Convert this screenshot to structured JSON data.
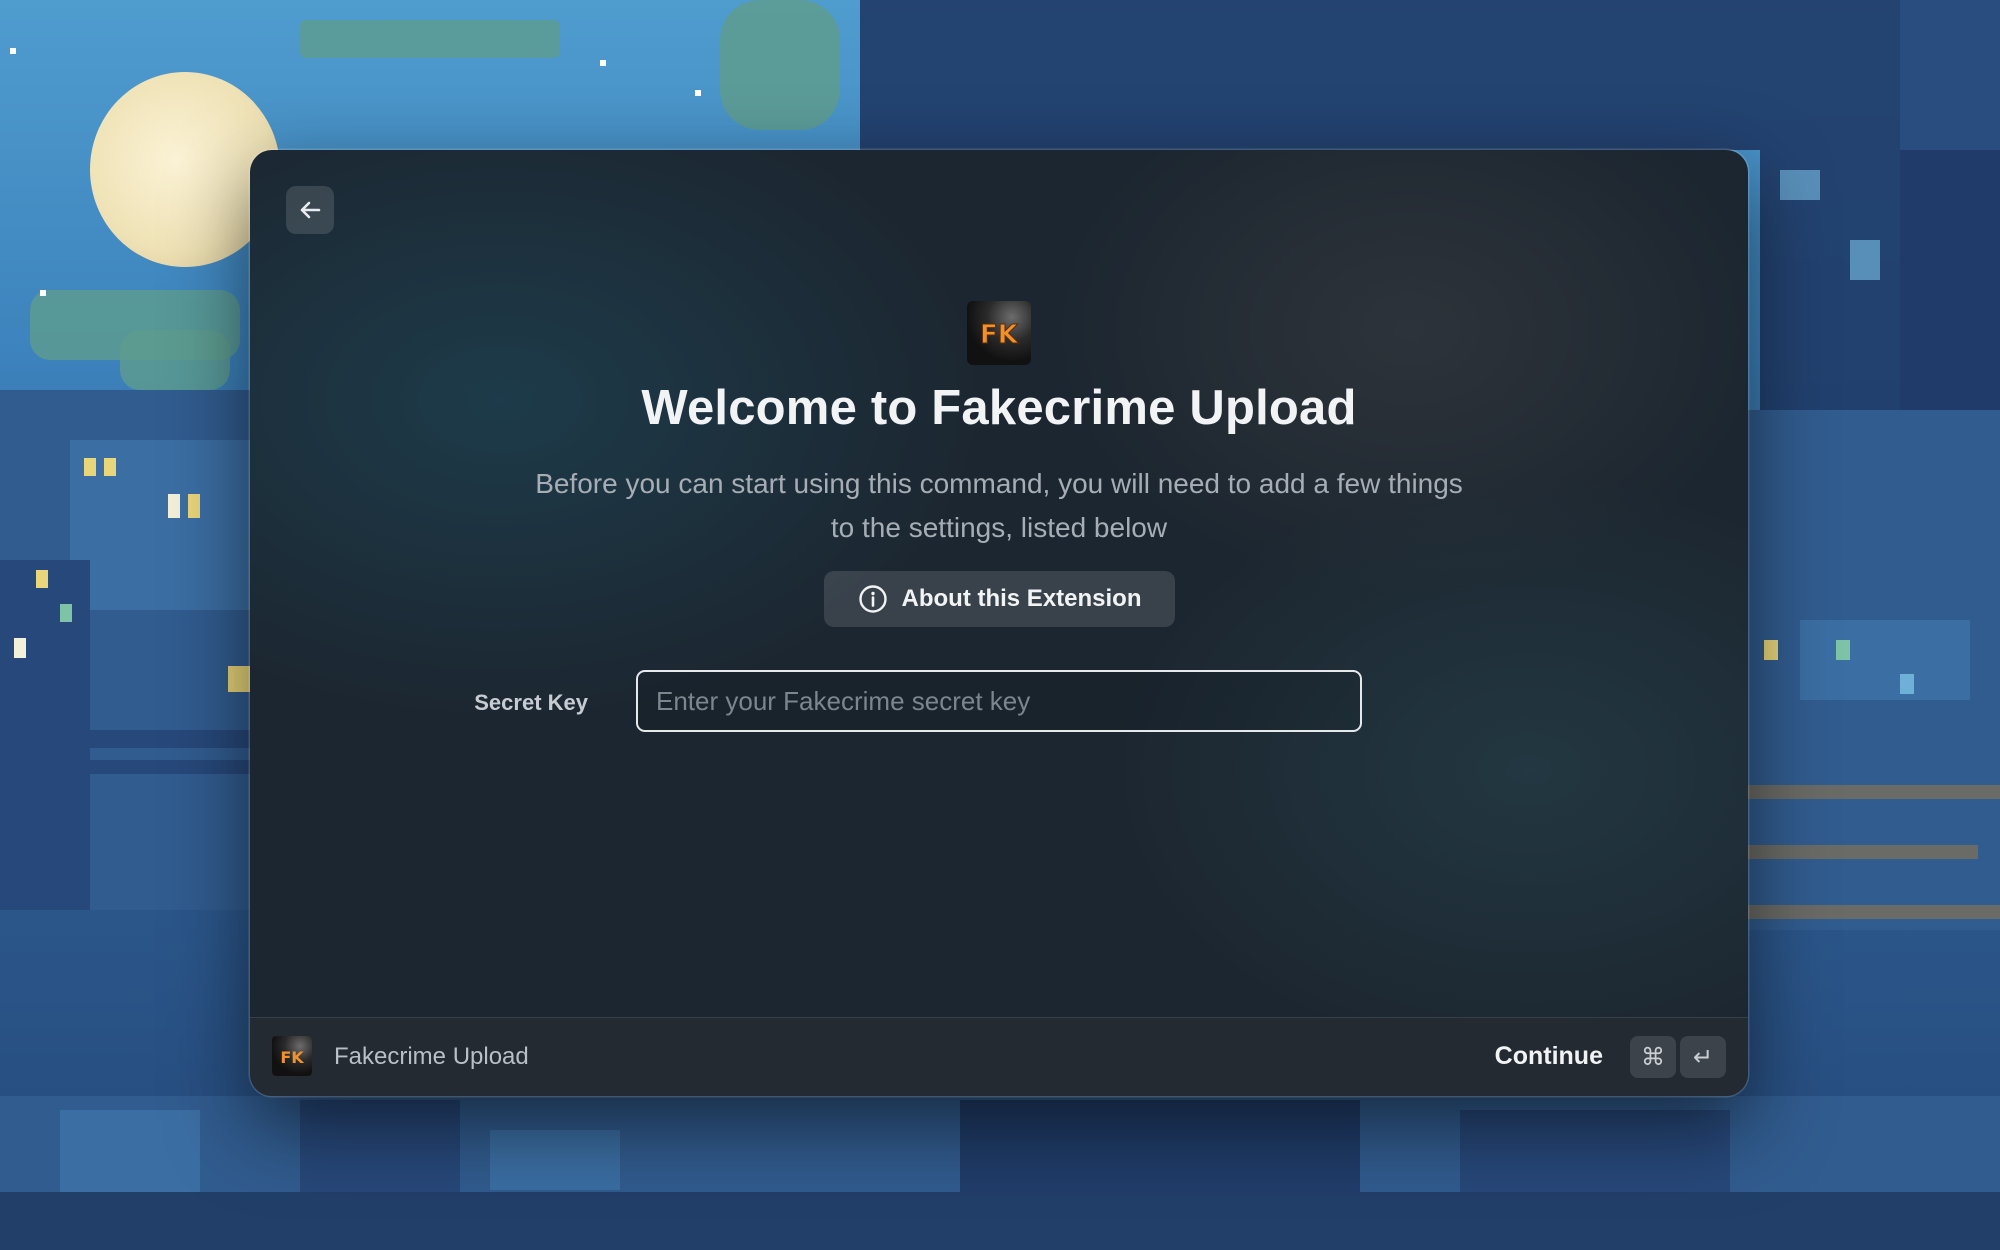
{
  "window": {
    "title": "Welcome to Fakecrime Upload",
    "subtitle": "Before you can start using this command, you will need to add a few things to the settings, listed below",
    "about_button_label": "About this Extension",
    "extension_icon_text": "FK",
    "back_icon": "arrow-left-icon",
    "info_icon": "info-circle-icon"
  },
  "form": {
    "secret_key": {
      "label": "Secret Key",
      "placeholder": "Enter your Fakecrime secret key",
      "value": ""
    }
  },
  "footer": {
    "extension_name": "Fakecrime Upload",
    "action_label": "Continue",
    "shortcut_keys": [
      "⌘",
      "↵"
    ]
  },
  "colors": {
    "accent_orange": "#f0912c",
    "window_background": "#1c2630",
    "footer_background": "#232a31"
  }
}
